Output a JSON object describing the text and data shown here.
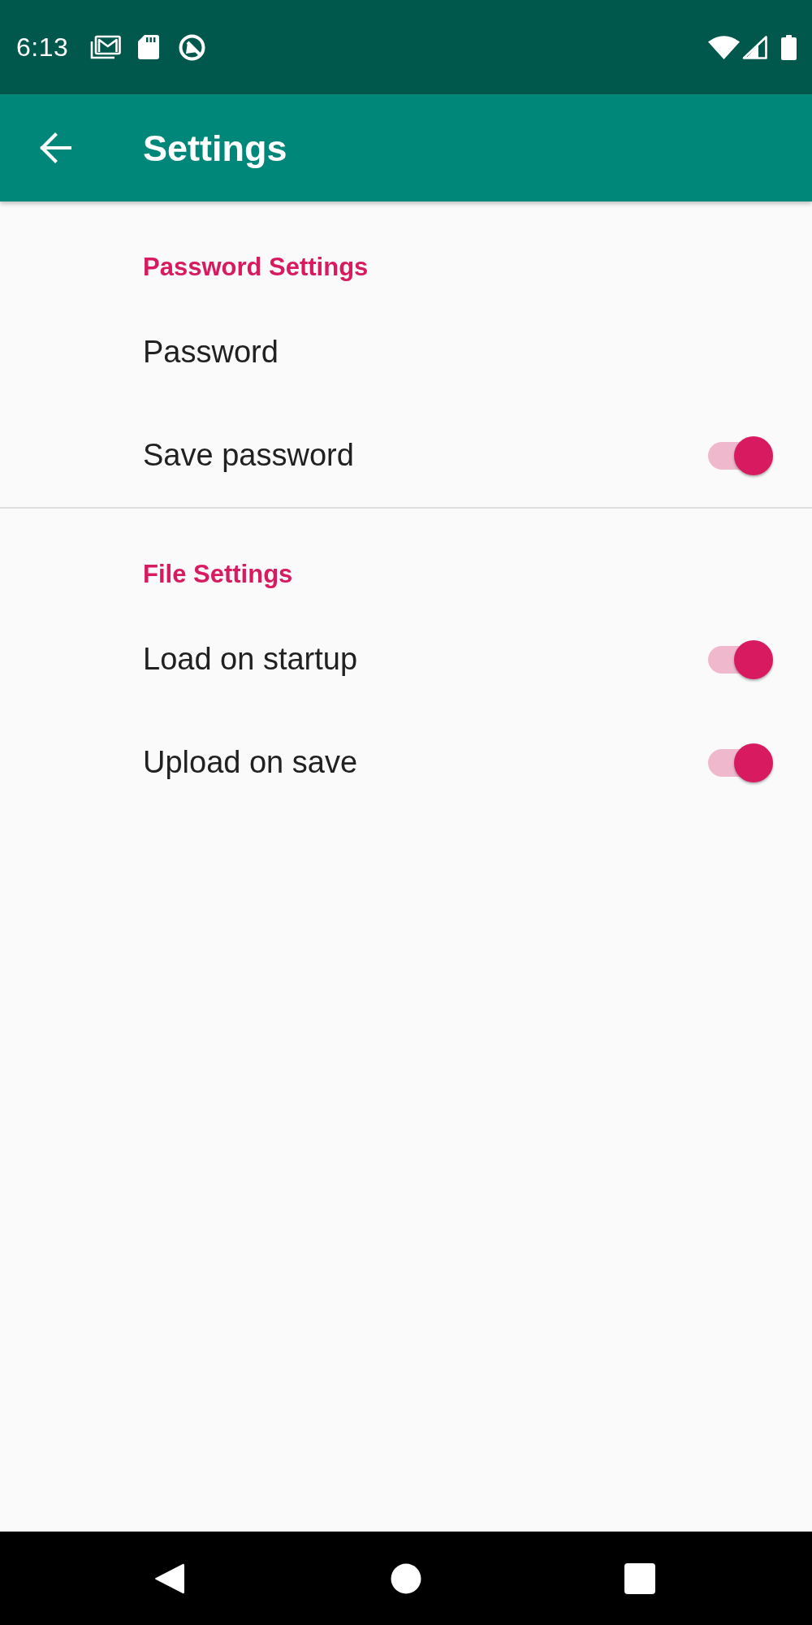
{
  "status_bar": {
    "time": "6:13"
  },
  "toolbar": {
    "title": "Settings"
  },
  "sections": [
    {
      "title": "Password Settings",
      "items": [
        {
          "kind": "text",
          "label": "Password"
        },
        {
          "kind": "switch",
          "label": "Save password",
          "on": true
        }
      ]
    },
    {
      "title": "File Settings",
      "items": [
        {
          "kind": "switch",
          "label": "Load on startup",
          "on": true
        },
        {
          "kind": "switch",
          "label": "Upload on save",
          "on": true
        }
      ]
    }
  ]
}
